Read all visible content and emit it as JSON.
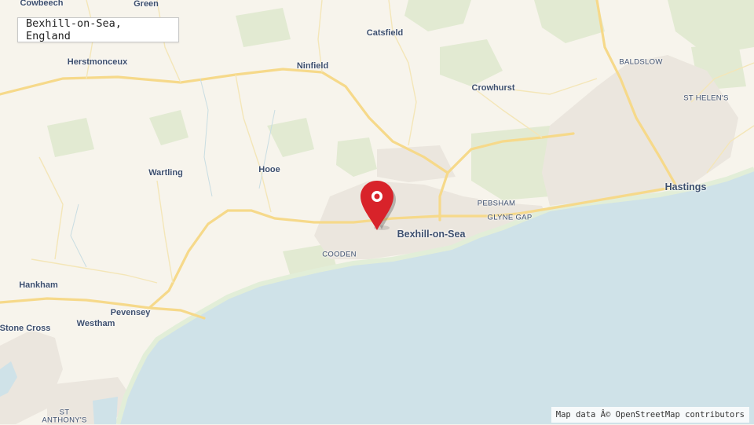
{
  "search": {
    "value": "Bexhill-on-Sea, England"
  },
  "attribution": "Map data Â© OpenStreetMap contributors",
  "colors": {
    "land": "#f7f4ec",
    "sea": "#cfe2e8",
    "forest": "#dfe8cc",
    "urban": "#e9e5dd",
    "road": "#f6dc8f",
    "pin": "#d8232a"
  },
  "places": {
    "cowbeech": "Cowbeech",
    "green": "Green",
    "catsfield": "Catsfield",
    "herstmonceux": "Herstmonceux",
    "ninfield": "Ninfield",
    "baldslow": "BALDSLOW",
    "crowhurst": "Crowhurst",
    "st_helens": "ST HELEN'S",
    "wartling": "Wartling",
    "hooe": "Hooe",
    "hastings": "Hastings",
    "pebsham": "PEBSHAM",
    "glyne_gap": "GLYNE GAP",
    "bexhill": "Bexhill-on-Sea",
    "cooden": "COODEN",
    "hankham": "Hankham",
    "pevensey": "Pevensey",
    "stone_cross": "Stone Cross",
    "westham": "Westham",
    "st_anthonys_1": "ST",
    "st_anthonys_2": "ANTHONY'S"
  }
}
